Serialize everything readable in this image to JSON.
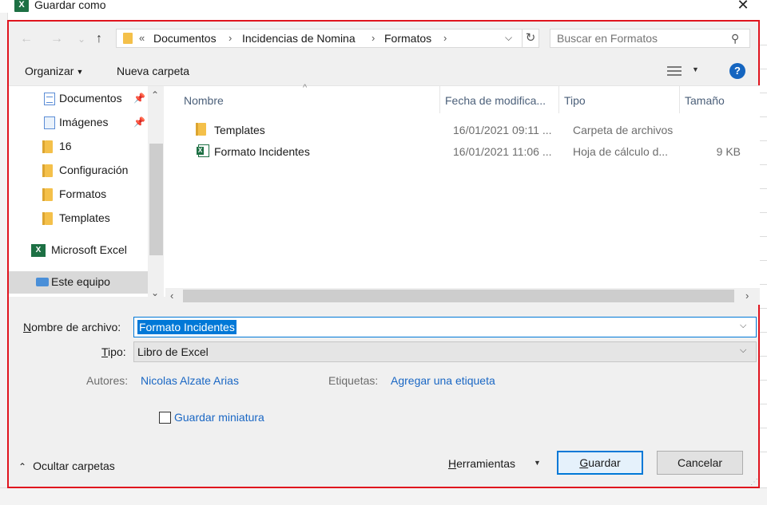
{
  "window": {
    "title": "Guardar como",
    "app_icon_letter": "X",
    "close_glyph": "✕"
  },
  "address": {
    "overflow": "«",
    "crumbs": [
      "Documentos",
      "Incidencias de Nomina",
      "Formatos"
    ],
    "separator": "›",
    "refresh_glyph": "↻",
    "dropdown_glyph": "⌵"
  },
  "nav_buttons": {
    "back": "←",
    "forward": "→",
    "recent": "⌄",
    "up": "↑"
  },
  "search": {
    "placeholder": "Buscar en Formatos",
    "icon": "search-icon",
    "glyph": "⚲"
  },
  "toolbar": {
    "organize": "Organizar",
    "new_folder": "Nueva carpeta",
    "caret": "▼",
    "help": "?"
  },
  "nav_pane": {
    "items": [
      {
        "label": "Documentos",
        "icon": "documents-icon",
        "pinned": true
      },
      {
        "label": "Imágenes",
        "icon": "images-icon",
        "pinned": true
      },
      {
        "label": "16",
        "icon": "folder-icon",
        "pinned": false
      },
      {
        "label": "Configuración",
        "icon": "folder-icon",
        "pinned": false
      },
      {
        "label": "Formatos",
        "icon": "folder-icon",
        "pinned": false
      },
      {
        "label": "Templates",
        "icon": "folder-icon",
        "pinned": false
      },
      {
        "label": "Microsoft Excel",
        "icon": "excel-icon",
        "pinned": false
      },
      {
        "label": "Este equipo",
        "icon": "computer-icon",
        "pinned": false,
        "selected": true
      }
    ],
    "pin_glyph": "📌",
    "scroll_up": "⌃",
    "scroll_down": "⌄"
  },
  "file_list": {
    "columns": [
      "Nombre",
      "Fecha de modifica...",
      "Tipo",
      "Tamaño"
    ],
    "sort_glyph": "^",
    "rows": [
      {
        "name": "Templates",
        "date": "16/01/2021 09:11 ...",
        "type": "Carpeta de archivos",
        "size": "",
        "icon": "folder-icon"
      },
      {
        "name": "Formato Incidentes",
        "date": "16/01/2021 11:06 ...",
        "type": "Hoja de cálculo d...",
        "size": "9 KB",
        "icon": "excel-file-icon"
      }
    ],
    "scroll_left": "‹",
    "scroll_right": "›"
  },
  "form": {
    "filename_label_prefix": "N",
    "filename_label_rest": "ombre de archivo:",
    "filename_value": "Formato Incidentes",
    "type_label_prefix": "T",
    "type_label_rest": "ipo:",
    "type_value": "Libro de Excel",
    "dropdown_glyph": "⌵",
    "authors_label": "Autores:",
    "authors_value": "Nicolas Alzate Arias",
    "tags_label": "Etiquetas:",
    "tags_value": "Agregar una etiqueta",
    "thumbnail_label": "Guardar miniatura",
    "thumbnail_checked": false
  },
  "footer": {
    "hide_folders": "Ocultar carpetas",
    "hide_chevron": "⌃",
    "tools_prefix": "H",
    "tools_rest": "erramientas",
    "tools_caret": "▼",
    "save_prefix": "G",
    "save_rest": "uardar",
    "cancel": "Cancelar",
    "grip": "⋰"
  },
  "colors": {
    "highlight_border": "#e0141e",
    "accent": "#0078d7",
    "link": "#1a67c4",
    "excel_green": "#1d7044",
    "folder_yellow": "#f4c04a"
  }
}
